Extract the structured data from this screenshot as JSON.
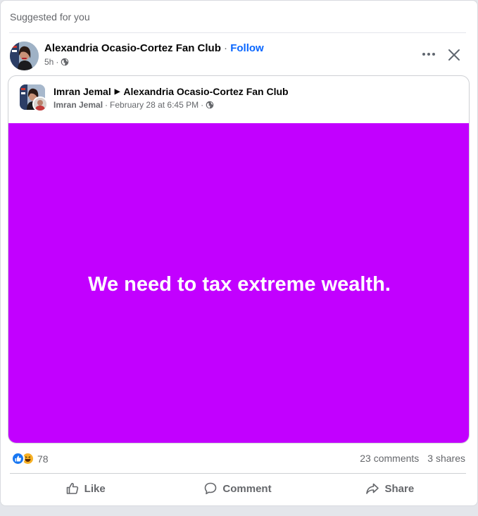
{
  "feed": {
    "section_label": "Suggested for you"
  },
  "post": {
    "page_name": "Alexandria Ocasio-Cortez Fan Club",
    "separator": " · ",
    "follow_label": "Follow",
    "time": "5h",
    "meta_separator": "·",
    "audience_icon": "globe-icon",
    "more_icon": "more-options-icon",
    "close_icon": "close-icon"
  },
  "shared_post": {
    "author": "Imran Jemal",
    "arrow": "▶",
    "group": "Alexandria Ocasio-Cortez Fan Club",
    "meta_author": "Imran Jemal",
    "meta_separator": "·",
    "date": "February 28 at 6:45 PM",
    "audience_icon": "globe-icon",
    "text": "We need to tax extreme wealth.",
    "background_color": "#c200ff"
  },
  "engagement": {
    "reaction_icons": [
      "like-icon",
      "haha-icon"
    ],
    "reaction_count": "78",
    "comments": "23 comments",
    "shares": "3 shares"
  },
  "actions": {
    "like_label": "Like",
    "comment_label": "Comment",
    "share_label": "Share"
  },
  "colors": {
    "accent": "#0866ff",
    "secondary_text": "#65676b",
    "like_blue": "#1877f2",
    "haha_yellow": "#f7b125"
  }
}
